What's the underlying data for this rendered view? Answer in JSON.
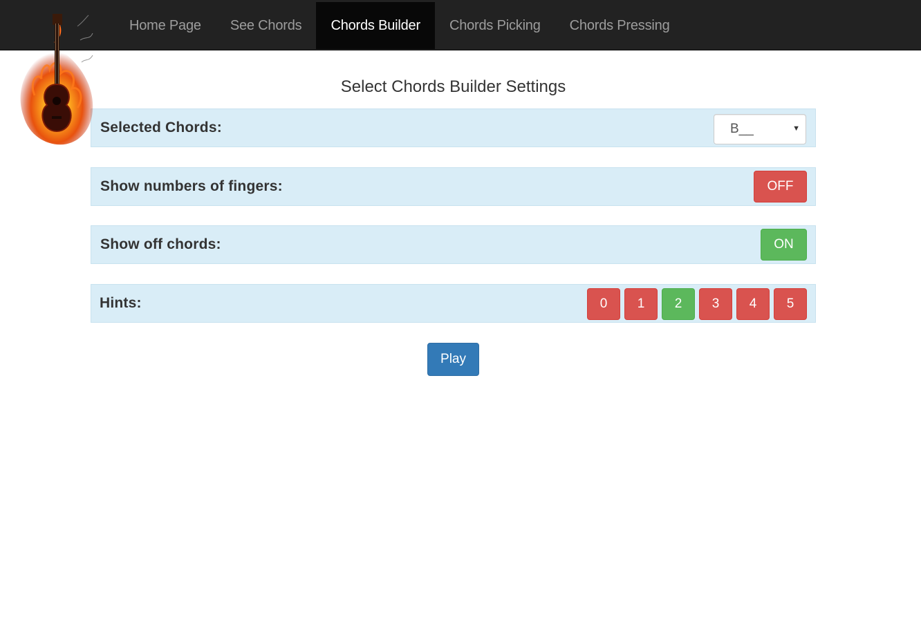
{
  "nav": {
    "items": [
      {
        "label": "Home Page",
        "active": false
      },
      {
        "label": "See Chords",
        "active": false
      },
      {
        "label": "Chords Builder",
        "active": true
      },
      {
        "label": "Chords Picking",
        "active": false
      },
      {
        "label": "Chords Pressing",
        "active": false
      }
    ]
  },
  "logo": {
    "icon": "flaming-guitar-icon"
  },
  "page": {
    "title": "Select Chords Builder Settings"
  },
  "settings": {
    "selected_chords": {
      "label": "Selected Chords:",
      "value": "B__"
    },
    "show_fingers": {
      "label": "Show numbers of fingers:",
      "state": "OFF"
    },
    "show_off_chords": {
      "label": "Show off chords:",
      "state": "ON"
    },
    "hints": {
      "label": "Hints:",
      "options": [
        {
          "label": "0",
          "selected": false
        },
        {
          "label": "1",
          "selected": false
        },
        {
          "label": "2",
          "selected": true
        },
        {
          "label": "3",
          "selected": false
        },
        {
          "label": "4",
          "selected": false
        },
        {
          "label": "5",
          "selected": false
        }
      ]
    }
  },
  "actions": {
    "play_label": "Play"
  },
  "colors": {
    "navbar": "#222222",
    "row_bg": "#d9edf7",
    "danger": "#d9534f",
    "success": "#5cb85c",
    "primary": "#337ab7"
  }
}
